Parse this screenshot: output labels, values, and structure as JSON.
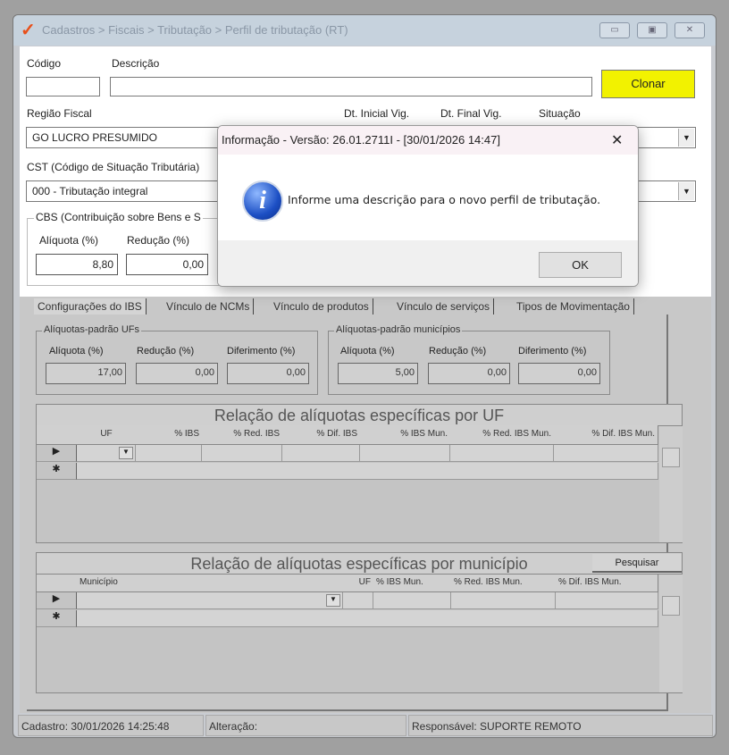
{
  "window": {
    "title": "Cadastros > Fiscais > Tributação > Perfil de tributação (RT)"
  },
  "form": {
    "codigo_label": "Código",
    "descricao_label": "Descrição",
    "codigo_value": "",
    "descricao_value": "",
    "clonar": "Clonar",
    "regiao_label": "Região Fiscal",
    "regiao_value": "GO LUCRO PRESUMIDO",
    "dt_inicial_label": "Dt. Inicial Vig.",
    "dt_final_label": "Dt. Final Vig.",
    "situacao_label": "Situação",
    "cst_label": "CST (Código de Situação Tributária)",
    "cst_value": "000 - Tributação integral",
    "cbs_label": "CBS (Contribuição sobre Bens e S",
    "cbs_aliquota_label": "Alíquota (%)",
    "cbs_aliquota": "8,80",
    "cbs_reducao_label": "Redução (%)",
    "cbs_reducao": "0,00"
  },
  "tabs": [
    "Configurações do IBS",
    "Vínculo de NCMs",
    "Vínculo de produtos",
    "Vínculo de serviços",
    "Tipos de Movimentação"
  ],
  "ibs": {
    "ufs": {
      "title": "Alíquotas-padrão UFs",
      "aliquota_label": "Alíquota (%)",
      "reducao_label": "Redução (%)",
      "diferimento_label": "Diferimento (%)",
      "aliquota": "17,00",
      "reducao": "0,00",
      "diferimento": "0,00"
    },
    "mun": {
      "title": "Alíquotas-padrão municípios",
      "aliquota_label": "Alíquota (%)",
      "reducao_label": "Redução (%)",
      "diferimento_label": "Diferimento (%)",
      "aliquota": "5,00",
      "reducao": "0,00",
      "diferimento": "0,00"
    }
  },
  "grid_uf": {
    "title": "Relação de alíquotas específicas por UF",
    "columns": [
      "UF",
      "% IBS",
      "% Red. IBS",
      "% Dif. IBS",
      "% IBS Mun.",
      "% Red. IBS Mun.",
      "% Dif. IBS Mun."
    ]
  },
  "grid_mun": {
    "title": "Relação de alíquotas específicas por município",
    "search": "Pesquisar",
    "columns": [
      "Município",
      "UF",
      "% IBS Mun.",
      "% Red. IBS Mun.",
      "% Dif. IBS Mun."
    ]
  },
  "status": {
    "cadastro": "Cadastro: 30/01/2026 14:25:48",
    "alteracao": "Alteração:",
    "responsavel": "Responsável: SUPORTE REMOTO"
  },
  "dialog": {
    "title": "Informação - Versão: 26.01.2711I - [30/01/2026 14:47]",
    "message": "Informe uma descrição para o novo perfil de tributação.",
    "ok": "OK",
    "close": "✕"
  }
}
